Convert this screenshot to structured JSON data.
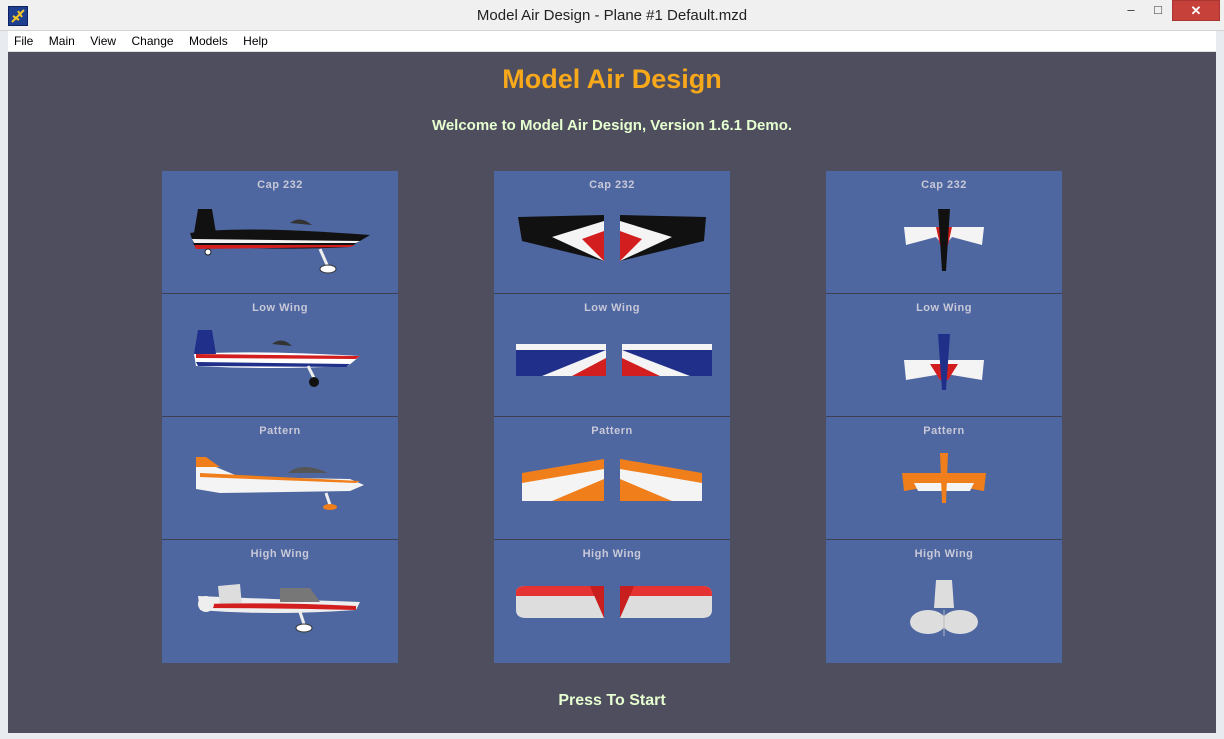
{
  "window": {
    "title": "Model Air Design - Plane #1  Default.mzd",
    "controls": {
      "minimize": "–",
      "maximize": "□",
      "close": "✕"
    }
  },
  "menu": [
    "File",
    "Main",
    "Change",
    "Models",
    "Help"
  ],
  "menu_full": [
    "File",
    "Main",
    "View",
    "Change",
    "Models",
    "Help"
  ],
  "app": {
    "title": "Model Air Design",
    "welcome": "Welcome to Model Air Design, Version 1.6.1 Demo.",
    "press_start": "Press To Start"
  },
  "models": [
    "Cap 232",
    "Low Wing",
    "Pattern",
    "High Wing"
  ],
  "views": [
    "side-view",
    "top-wing-view",
    "tail-view"
  ],
  "colors": {
    "title": "#f7a81b",
    "panel": "#4e67a0",
    "background": "#4f4e5e",
    "text_light": "#e6ffd0"
  }
}
